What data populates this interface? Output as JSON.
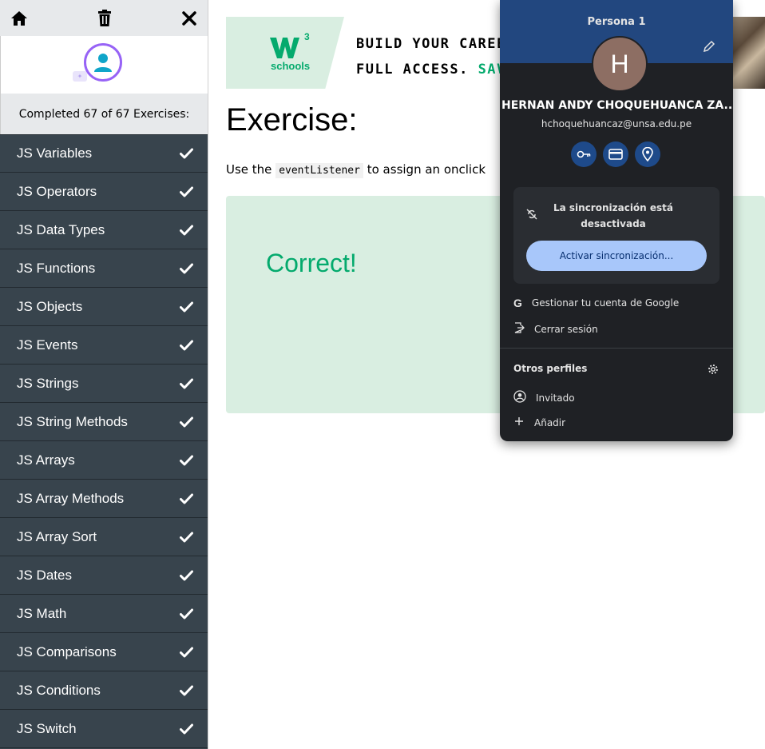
{
  "sidebar": {
    "completed_text": "Completed 67 of 67 Exercises:",
    "exercises": [
      "JS Variables",
      "JS Operators",
      "JS Data Types",
      "JS Functions",
      "JS Objects",
      "JS Events",
      "JS Strings",
      "JS String Methods",
      "JS Arrays",
      "JS Array Methods",
      "JS Array Sort",
      "JS Dates",
      "JS Math",
      "JS Comparisons",
      "JS Conditions",
      "JS Switch"
    ]
  },
  "banner": {
    "logo_sup": "3",
    "logo_word": "schools",
    "line1": "BUILD YOUR CAREE",
    "line2_prefix": "FULL ACCESS. ",
    "line2_accent": "SAV"
  },
  "main": {
    "title": "Exercise:",
    "instruction_pre": "Use the",
    "instruction_code": "eventListener",
    "instruction_post": "to assign an onclick",
    "result": "Correct!"
  },
  "profile": {
    "persona": "Persona 1",
    "initial": "H",
    "name": "HERNAN ANDY CHOQUEHUANCA ZA...",
    "email": "hchoquehuancaz@unsa.edu.pe",
    "sync_line1": "La sincronización está",
    "sync_line2": "desactivada",
    "sync_button": "Activar sincronización...",
    "manage_account": "Gestionar tu cuenta de Google",
    "sign_out": "Cerrar sesión",
    "other_profiles": "Otros perfiles",
    "guest": "Invitado",
    "add": "Añadir"
  },
  "colors": {
    "sidebar_bg": "#38444d",
    "w3_green": "#04aa6d",
    "result_bg": "#d9eee1",
    "popup_bg": "#1f2125",
    "popup_header": "#22477f",
    "sync_button_bg": "#a8c7fa"
  }
}
